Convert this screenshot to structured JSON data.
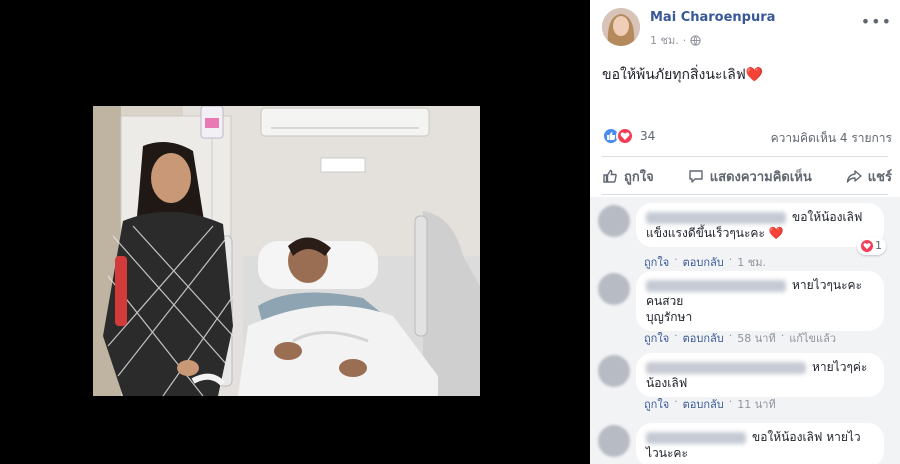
{
  "post": {
    "author": "Mai Charoenpura",
    "time": "1 ชม.",
    "text": "ขอให้พ้นภัยทุกสิ่งนะเลิฟ",
    "heart": "❤️",
    "reaction_count": "34",
    "comment_count": "ความคิดเห็น 4 รายการ"
  },
  "actions": {
    "like": "ถูกใจ",
    "comment": "แสดงความคิดเห็น",
    "share": "แชร์"
  },
  "comments": [
    {
      "lines": [
        "ขอให้น้องเลิฟ",
        "แข็งแรงดีขึ้นเร็วๆนะคะ"
      ],
      "heart": "❤️",
      "reaction_count": "1",
      "like": "ถูกใจ",
      "reply": "ตอบกลับ",
      "time": "1 ชม."
    },
    {
      "lines": [
        "หายไวๆนะคะ",
        "คนสวย",
        "บุญรักษา"
      ],
      "like": "ถูกใจ",
      "reply": "ตอบกลับ",
      "time": "58 นาที",
      "edited": "แก้ไขแล้ว"
    },
    {
      "lines": [
        "หายไวๆค่ะ",
        "น้องเลิฟ"
      ],
      "like": "ถูกใจ",
      "reply": "ตอบกลับ",
      "time": "11 นาที"
    },
    {
      "lines": [
        "ขอให้น้องเลิฟ หายไว",
        "ไวนะคะ"
      ]
    }
  ],
  "icons": {
    "globe": "globe-icon",
    "more": "more-options-icon",
    "like": "thumbs-up-icon",
    "love": "heart-icon",
    "comment": "speech-bubble-icon",
    "share": "share-arrow-icon"
  },
  "colors": {
    "link": "#385898",
    "like_blue": "#4a8af4",
    "love_red": "#f33e58",
    "comment_bg": "#f2f3f5"
  }
}
